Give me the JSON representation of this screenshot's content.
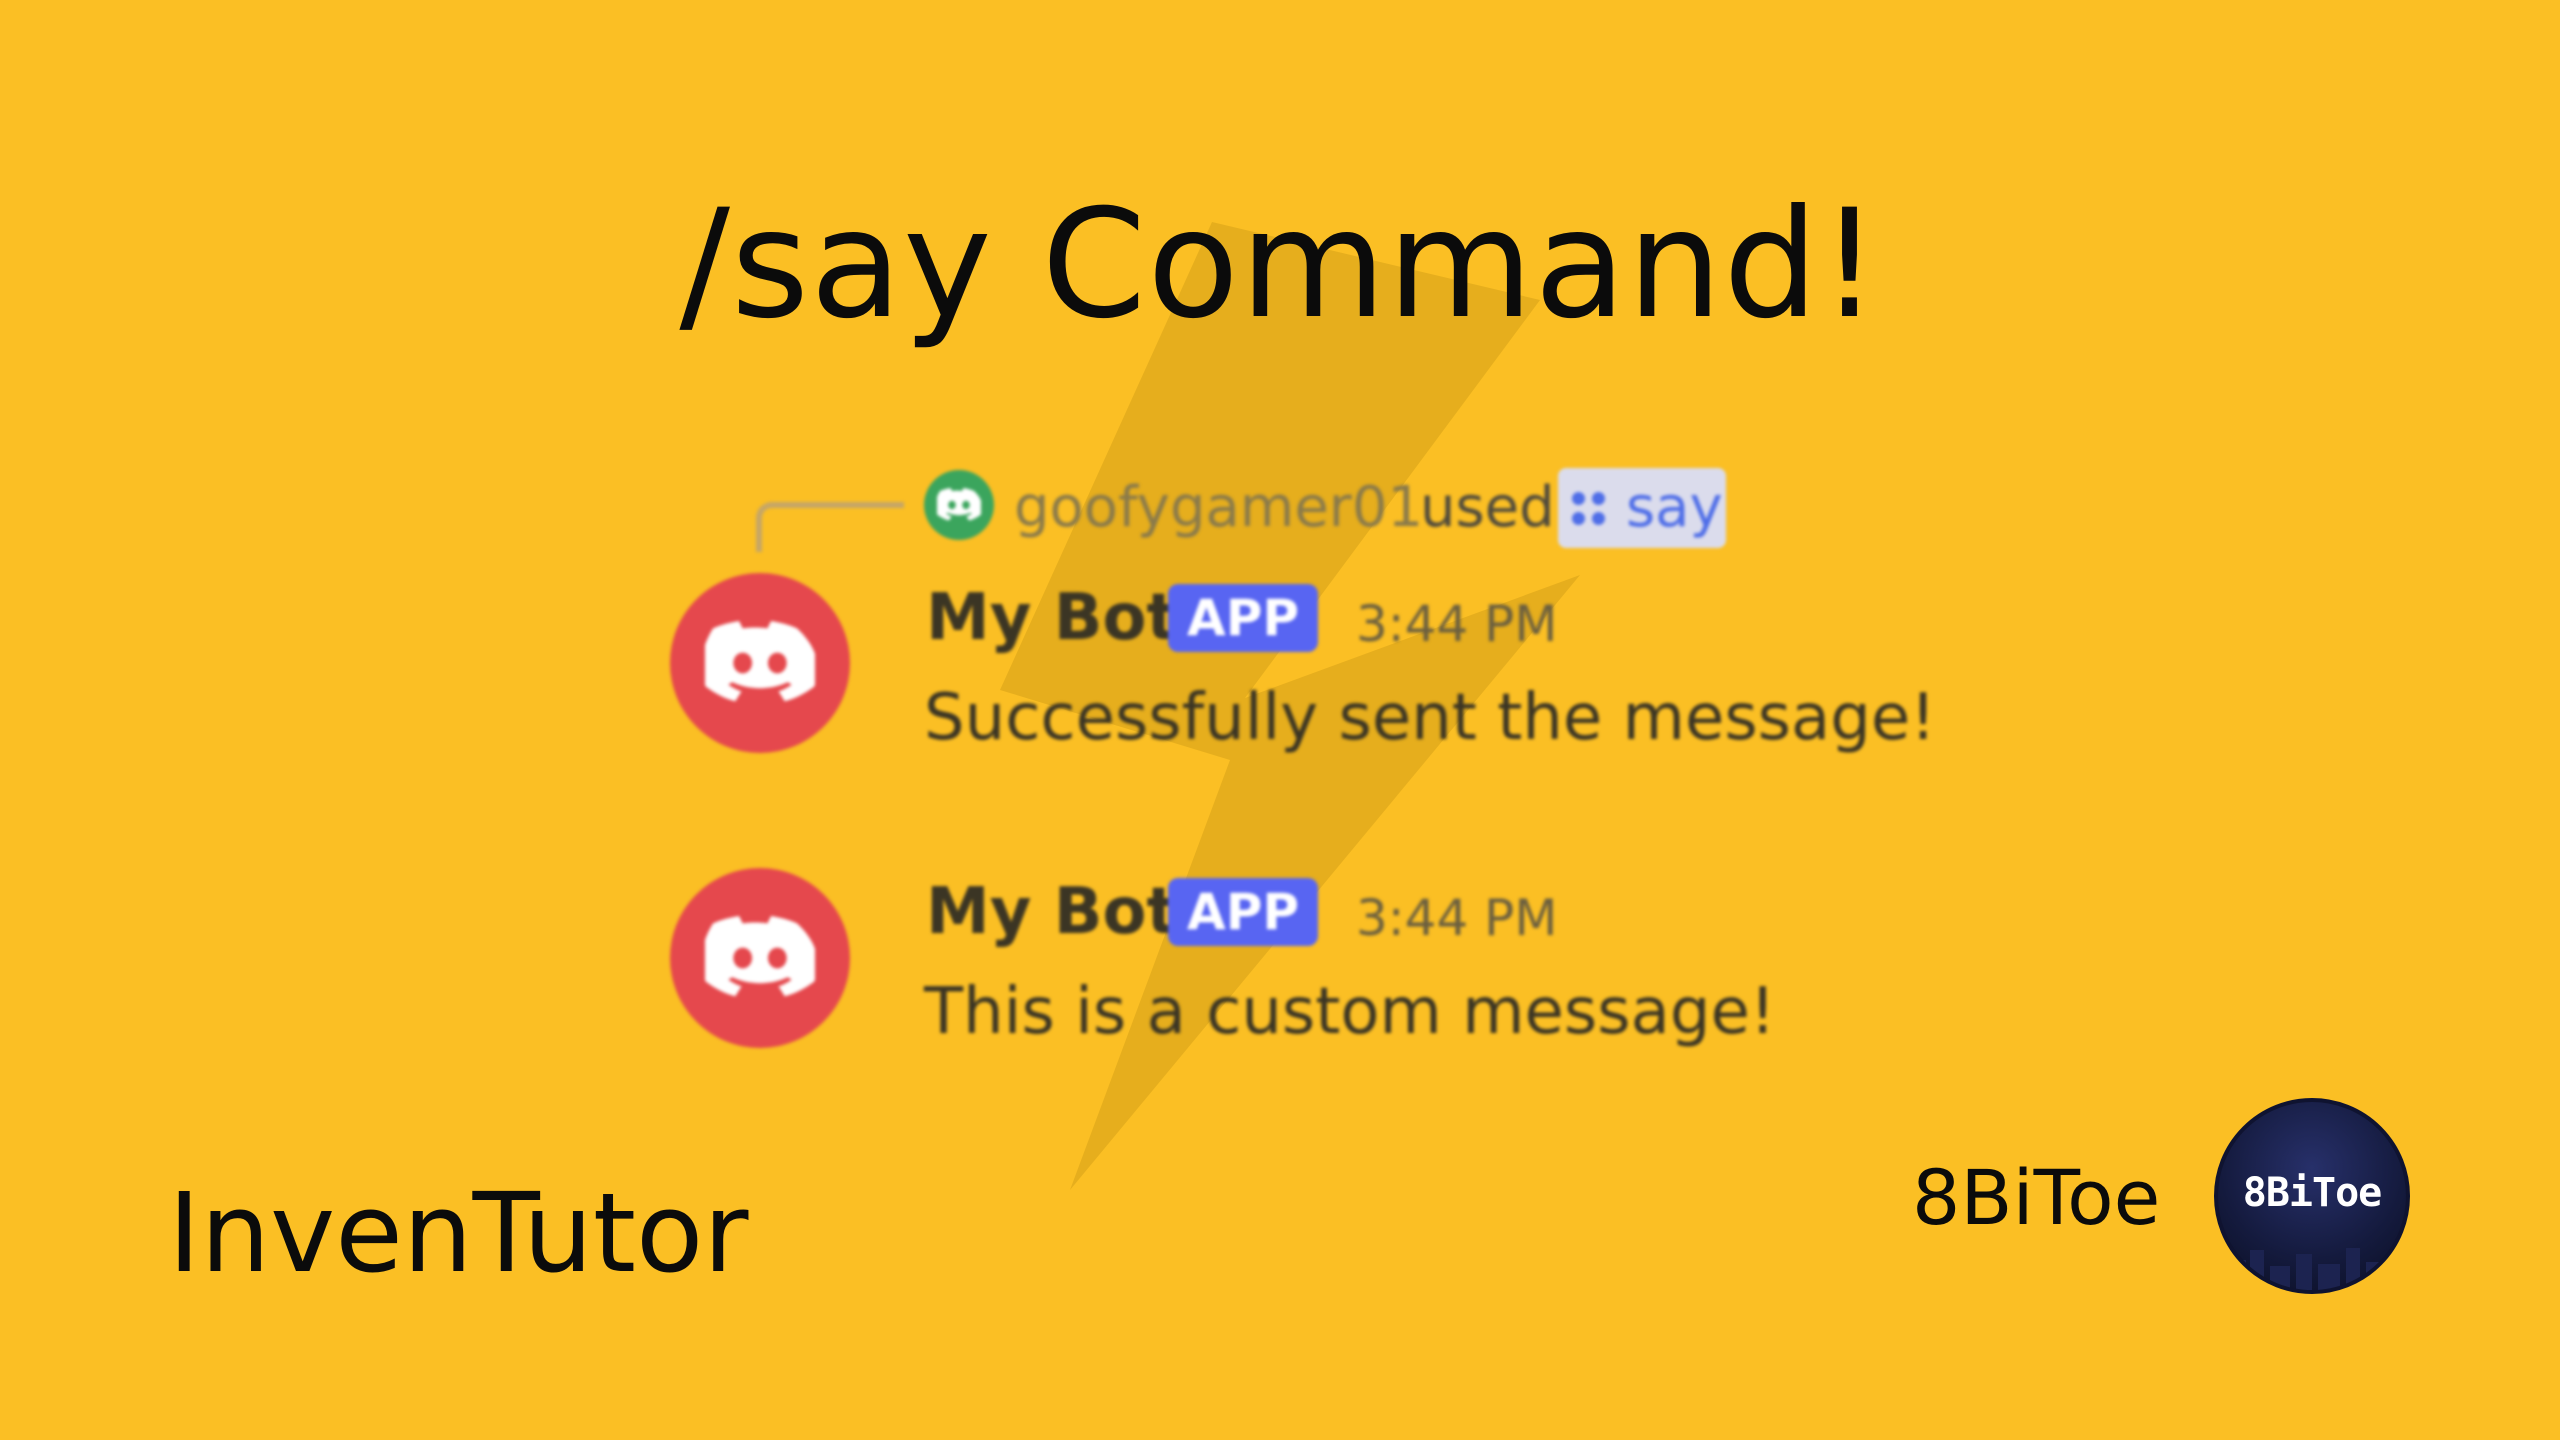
{
  "title": "/say Command!",
  "invocation": {
    "username": "goofygamer01",
    "used_label": "used",
    "command": "say"
  },
  "messages": [
    {
      "author": "My Bot",
      "badge": "APP",
      "time": "3:44 PM",
      "text": "Successfully sent the message!"
    },
    {
      "author": "My Bot",
      "badge": "APP",
      "time": "3:44 PM",
      "text": "This is a custom message!"
    }
  ],
  "brand_left": "InvenTutor",
  "brand_right": "8BiToe",
  "logo_text": "8BiToe",
  "colors": {
    "background": "#FBBF24",
    "bot_avatar": "#E5484D",
    "user_avatar": "#3BA55D",
    "app_badge": "#5865F2",
    "command_chip": "#DBDCEC"
  },
  "icons": {
    "avatar_icon": "discord-logo-icon",
    "command_icon": "slash-command-icon",
    "background_graphic": "lightning-bolt-icon"
  }
}
